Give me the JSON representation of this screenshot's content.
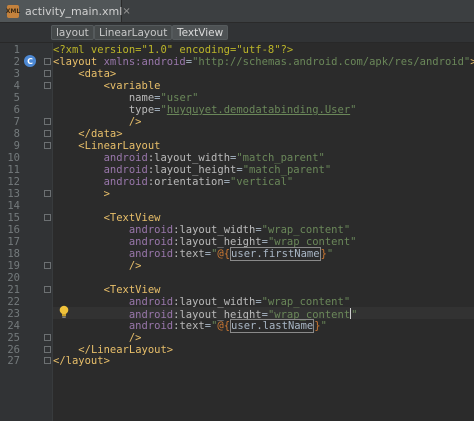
{
  "tab": {
    "label": "activity_main.xml",
    "close": "×",
    "file_icon": "xml-file-icon",
    "file_icon_text": "XML"
  },
  "breadcrumbs": [
    "layout",
    "LinearLayout",
    "TextView"
  ],
  "editor": {
    "current_line": 23,
    "line_numbers": [
      "1",
      "2",
      "3",
      "4",
      "5",
      "6",
      "7",
      "8",
      "9",
      "10",
      "11",
      "12",
      "13",
      "14",
      "15",
      "16",
      "17",
      "18",
      "19",
      "20",
      "21",
      "22",
      "23",
      "24",
      "25",
      "26",
      "27"
    ],
    "gutter_markers": {
      "override_icon_line": 2,
      "override_icon": "C",
      "intention_bulb_line": 23
    },
    "lines": [
      [
        [
          "pi",
          "<?xml version=\"1.0\" encoding=\"utf-8\"?>"
        ]
      ],
      [
        [
          "tg",
          "<layout "
        ],
        [
          "ns",
          "xmlns:android"
        ],
        [
          "pl",
          "="
        ],
        [
          "av",
          "\"http://schemas.android.com/apk/res/android\""
        ],
        [
          "tg",
          ">"
        ]
      ],
      [
        [
          "pl",
          "    "
        ],
        [
          "tg",
          "<data>"
        ]
      ],
      [
        [
          "pl",
          "        "
        ],
        [
          "tg",
          "<variable"
        ]
      ],
      [
        [
          "pl",
          "            "
        ],
        [
          "an",
          "name"
        ],
        [
          "pl",
          "="
        ],
        [
          "av",
          "\"user\""
        ]
      ],
      [
        [
          "pl",
          "            "
        ],
        [
          "an",
          "type"
        ],
        [
          "pl",
          "="
        ],
        [
          "av",
          "\""
        ],
        [
          "avu",
          "huyquyet.demodatabinding.User"
        ],
        [
          "av",
          "\""
        ]
      ],
      [
        [
          "pl",
          "            "
        ],
        [
          "tg",
          "/>"
        ]
      ],
      [
        [
          "pl",
          "    "
        ],
        [
          "tg",
          "</data>"
        ]
      ],
      [
        [
          "pl",
          "    "
        ],
        [
          "tg",
          "<LinearLayout"
        ]
      ],
      [
        [
          "pl",
          "        "
        ],
        [
          "ns",
          "android"
        ],
        [
          "an",
          ":layout_width"
        ],
        [
          "pl",
          "="
        ],
        [
          "av",
          "\"match_parent\""
        ]
      ],
      [
        [
          "pl",
          "        "
        ],
        [
          "ns",
          "android"
        ],
        [
          "an",
          ":layout_height"
        ],
        [
          "pl",
          "="
        ],
        [
          "av",
          "\"match_parent\""
        ]
      ],
      [
        [
          "pl",
          "        "
        ],
        [
          "ns",
          "android"
        ],
        [
          "an",
          ":orientation"
        ],
        [
          "pl",
          "="
        ],
        [
          "av",
          "\"vertical\""
        ]
      ],
      [
        [
          "pl",
          "        "
        ],
        [
          "tg",
          ">"
        ]
      ],
      [],
      [
        [
          "pl",
          "        "
        ],
        [
          "tg",
          "<TextView"
        ]
      ],
      [
        [
          "pl",
          "            "
        ],
        [
          "ns",
          "android"
        ],
        [
          "an",
          ":layout_width"
        ],
        [
          "pl",
          "="
        ],
        [
          "av",
          "\"wrap_content\""
        ]
      ],
      [
        [
          "pl",
          "            "
        ],
        [
          "ns",
          "android"
        ],
        [
          "an",
          ":layout_height"
        ],
        [
          "pl",
          "="
        ],
        [
          "av",
          "\"wrap_content\""
        ]
      ],
      [
        [
          "pl",
          "            "
        ],
        [
          "ns",
          "android"
        ],
        [
          "an",
          ":text"
        ],
        [
          "pl",
          "="
        ],
        [
          "av",
          "\""
        ],
        [
          "ex",
          "@{"
        ],
        [
          "hl",
          "user.firstName"
        ],
        [
          "ex",
          "}"
        ],
        [
          "av",
          "\""
        ]
      ],
      [
        [
          "pl",
          "            "
        ],
        [
          "tg",
          "/>"
        ]
      ],
      [],
      [
        [
          "pl",
          "        "
        ],
        [
          "tg",
          "<TextView"
        ]
      ],
      [
        [
          "pl",
          "            "
        ],
        [
          "ns",
          "android"
        ],
        [
          "an",
          ":layout_width"
        ],
        [
          "pl",
          "="
        ],
        [
          "av",
          "\"wrap_content\""
        ]
      ],
      [
        [
          "pl",
          "            "
        ],
        [
          "ns",
          "android"
        ],
        [
          "an",
          ":layout_height"
        ],
        [
          "pl",
          "="
        ],
        [
          "av",
          "\"wrap_content"
        ],
        [
          "caret",
          ""
        ],
        [
          "av",
          "\""
        ]
      ],
      [
        [
          "pl",
          "            "
        ],
        [
          "ns",
          "android"
        ],
        [
          "an",
          ":text"
        ],
        [
          "pl",
          "="
        ],
        [
          "av",
          "\""
        ],
        [
          "ex",
          "@{"
        ],
        [
          "hl",
          "user.lastName"
        ],
        [
          "ex",
          "}"
        ],
        [
          "av",
          "\""
        ]
      ],
      [
        [
          "pl",
          "            "
        ],
        [
          "tg",
          "/>"
        ]
      ],
      [
        [
          "pl",
          "    "
        ],
        [
          "tg",
          "</LinearLayout>"
        ]
      ],
      [
        [
          "tg",
          "</layout>"
        ]
      ]
    ]
  }
}
